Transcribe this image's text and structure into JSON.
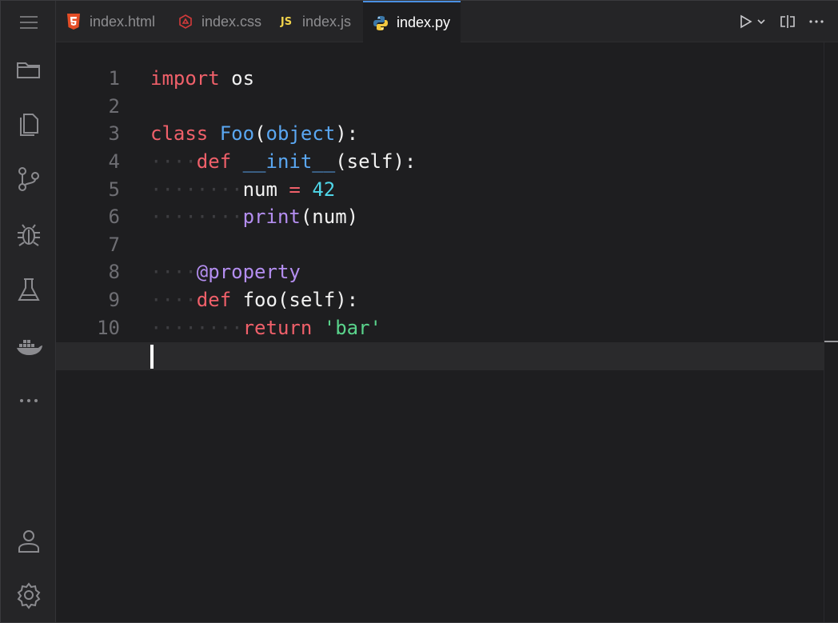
{
  "tabs": [
    {
      "label": "index.html",
      "icon": "html5-icon",
      "color": "#e44d26"
    },
    {
      "label": "index.css",
      "icon": "css-icon",
      "color": "#d33a3a"
    },
    {
      "label": "index.js",
      "icon": "js-icon",
      "badge": "JS",
      "color": "#f1d34b"
    },
    {
      "label": "index.py",
      "icon": "python-icon",
      "active": true
    }
  ],
  "activity": [
    "menu-icon",
    "folder-icon",
    "files-icon",
    "source-control-icon",
    "debug-icon",
    "test-flask-icon",
    "docker-icon",
    "more-icon",
    "account-icon",
    "settings-icon"
  ],
  "editor": {
    "line_numbers": [
      "1",
      "2",
      "3",
      "4",
      "5",
      "6",
      "7",
      "8",
      "9",
      "10"
    ],
    "lines": [
      {
        "tokens": [
          {
            "t": "import",
            "c": "kw"
          },
          {
            "t": " os",
            "c": "pl"
          }
        ]
      },
      {
        "tokens": []
      },
      {
        "tokens": [
          {
            "t": "class",
            "c": "kw"
          },
          {
            "t": " ",
            "c": "pl"
          },
          {
            "t": "Foo",
            "c": "cls"
          },
          {
            "t": "(",
            "c": "pl"
          },
          {
            "t": "object",
            "c": "cls"
          },
          {
            "t": "):",
            "c": "pl"
          }
        ]
      },
      {
        "indent": "····",
        "tokens": [
          {
            "t": "def",
            "c": "kw"
          },
          {
            "t": " ",
            "c": "pl"
          },
          {
            "t": "__init__",
            "c": "fn"
          },
          {
            "t": "(self):",
            "c": "pl"
          }
        ]
      },
      {
        "indent": "········",
        "tokens": [
          {
            "t": "num",
            "c": "pl"
          },
          {
            "t": " = ",
            "c": "op"
          },
          {
            "t": "42",
            "c": "num"
          }
        ]
      },
      {
        "indent": "········",
        "tokens": [
          {
            "t": "print",
            "c": "bi"
          },
          {
            "t": "(num)",
            "c": "pl"
          }
        ]
      },
      {
        "tokens": []
      },
      {
        "indent": "····",
        "tokens": [
          {
            "t": "@property",
            "c": "dec"
          }
        ]
      },
      {
        "indent": "····",
        "tokens": [
          {
            "t": "def",
            "c": "kw"
          },
          {
            "t": " foo(self):",
            "c": "pl"
          }
        ]
      },
      {
        "indent": "········",
        "tokens": [
          {
            "t": "return",
            "c": "kw"
          },
          {
            "t": " ",
            "c": "pl"
          },
          {
            "t": "'bar'",
            "c": "str"
          }
        ]
      }
    ]
  }
}
